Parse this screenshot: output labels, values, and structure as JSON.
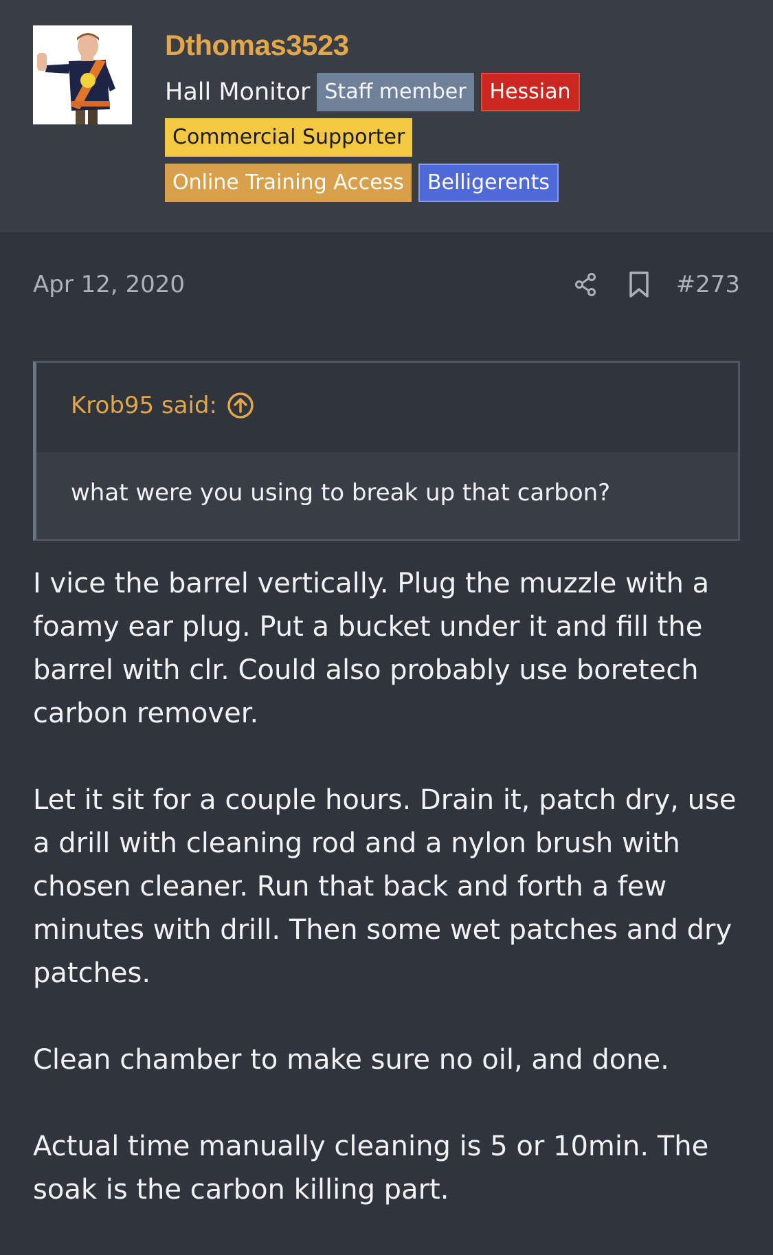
{
  "user": {
    "username": "Dthomas3523",
    "title": "Hall Monitor",
    "badges": {
      "staff": "Staff member",
      "hessian": "Hessian",
      "commercial": "Commercial Supporter",
      "training": "Online Training Access",
      "belligerents": "Belligerents"
    }
  },
  "post": {
    "date": "Apr 12, 2020",
    "number": "#273",
    "quote": {
      "author": "Krob95 said:",
      "text": "what were you using to break up that carbon?"
    },
    "paragraphs": [
      "I vice the barrel vertically. Plug the muzzle with a foamy ear plug. Put a bucket under it and fill the barrel with clr. Could also probably use boretech carbon remover.",
      "Let it sit for a couple hours. Drain it, patch dry, use a drill with cleaning rod and a nylon brush with chosen cleaner. Run that back and forth a few minutes with drill. Then some wet patches and dry patches.",
      "Clean chamber to make sure no oil, and done.",
      "Actual time manually cleaning is 5 or 10min. The soak is the carbon killing part."
    ]
  },
  "colors": {
    "background": "#30343d",
    "header_background": "#383d46",
    "username": "#e3a649",
    "meta_text": "#aeb1b7"
  },
  "icons": {
    "share": "share-icon",
    "bookmark": "bookmark-icon",
    "quote_jump": "arrow-up-circle-icon"
  }
}
